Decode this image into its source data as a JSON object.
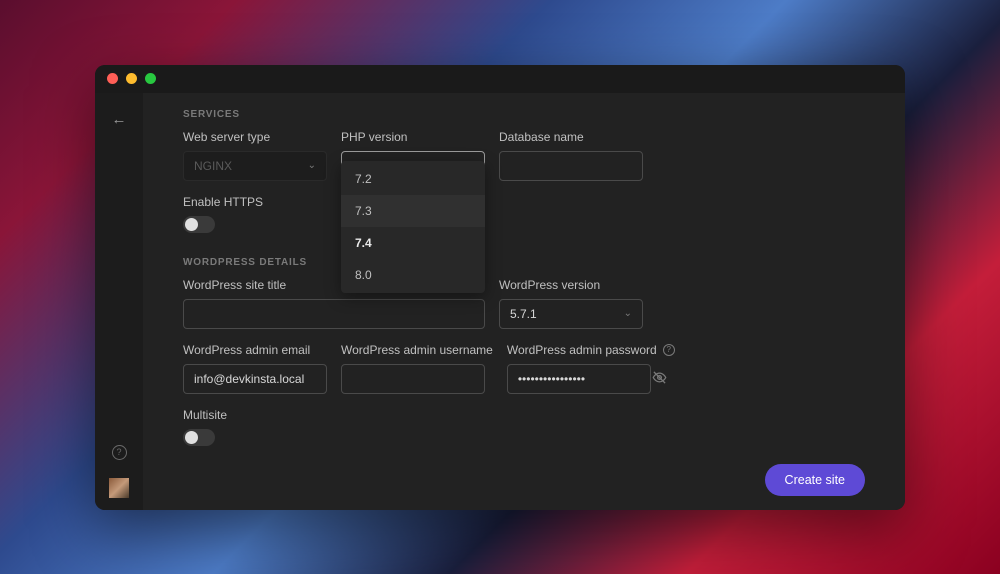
{
  "sections": {
    "services": "SERVICES",
    "wordpress": "WORDPRESS DETAILS"
  },
  "fields": {
    "web_server_type": {
      "label": "Web server type",
      "value": "NGINX"
    },
    "php_version": {
      "label": "PHP version",
      "value": "7.4"
    },
    "database_name": {
      "label": "Database name",
      "value": ""
    },
    "enable_https": {
      "label": "Enable HTTPS"
    },
    "wp_title": {
      "label": "WordPress site title",
      "value": ""
    },
    "wp_version": {
      "label": "WordPress version",
      "value": "5.7.1"
    },
    "wp_email": {
      "label": "WordPress admin email",
      "value": "info@devkinsta.local"
    },
    "wp_username": {
      "label": "WordPress admin username",
      "value": ""
    },
    "wp_password": {
      "label": "WordPress admin password",
      "value": "••••••••••••••••"
    },
    "multisite": {
      "label": "Multisite"
    }
  },
  "php_options": [
    "7.2",
    "7.3",
    "7.4",
    "8.0"
  ],
  "buttons": {
    "create": "Create site"
  }
}
